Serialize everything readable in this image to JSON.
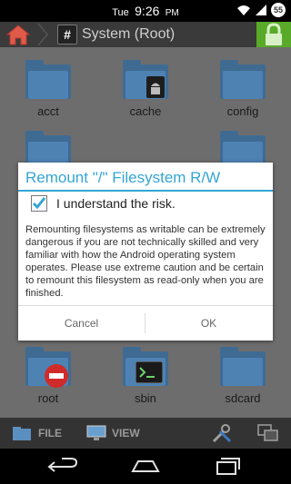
{
  "status_bar": {
    "day": "Tue",
    "time": "9:26",
    "ampm": "PM",
    "battery": "55"
  },
  "action_bar": {
    "path_icon": "#",
    "title": "System (Root)"
  },
  "folders": [
    {
      "label": "acct",
      "icon": "folder-icon"
    },
    {
      "label": "cache",
      "icon": "folder-android-icon"
    },
    {
      "label": "config",
      "icon": "folder-icon"
    },
    {
      "label": "root",
      "icon": "folder-restricted-icon"
    },
    {
      "label": "sbin",
      "icon": "folder-terminal-icon"
    },
    {
      "label": "sdcard",
      "icon": "folder-icon"
    }
  ],
  "dialog": {
    "title": "Remount \"/\" Filesystem R/W",
    "checkbox_label": "I understand the risk.",
    "checked": true,
    "body": "Remounting filesystems as writable can be extremely dangerous if you are not technically skilled and very familiar with how the Android operating system operates. Please use extreme caution and be certain to remount this filesystem as read-only when you are finished.",
    "cancel_label": "Cancel",
    "ok_label": "OK"
  },
  "toolbar": {
    "file_label": "FILE",
    "view_label": "VIEW"
  },
  "colors": {
    "accent": "#33a6d3",
    "lock": "#5aaa2a",
    "folder": "#4d82b3"
  }
}
